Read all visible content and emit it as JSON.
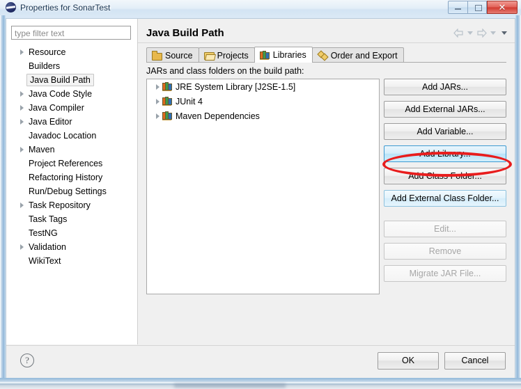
{
  "window": {
    "title": "Properties for SonarTest",
    "app_icon": "eclipse-icon",
    "minimize_label": "",
    "maximize_label": "",
    "close_label": "✕"
  },
  "filter": {
    "placeholder": "type filter text",
    "value": ""
  },
  "sidebar": {
    "items": [
      {
        "label": "Resource",
        "expandable": true,
        "selected": false
      },
      {
        "label": "Builders",
        "expandable": false,
        "selected": false
      },
      {
        "label": "Java Build Path",
        "expandable": false,
        "selected": true
      },
      {
        "label": "Java Code Style",
        "expandable": true,
        "selected": false
      },
      {
        "label": "Java Compiler",
        "expandable": true,
        "selected": false
      },
      {
        "label": "Java Editor",
        "expandable": true,
        "selected": false
      },
      {
        "label": "Javadoc Location",
        "expandable": false,
        "selected": false
      },
      {
        "label": "Maven",
        "expandable": true,
        "selected": false
      },
      {
        "label": "Project References",
        "expandable": false,
        "selected": false
      },
      {
        "label": "Refactoring History",
        "expandable": false,
        "selected": false
      },
      {
        "label": "Run/Debug Settings",
        "expandable": false,
        "selected": false
      },
      {
        "label": "Task Repository",
        "expandable": true,
        "selected": false
      },
      {
        "label": "Task Tags",
        "expandable": false,
        "selected": false
      },
      {
        "label": "TestNG",
        "expandable": false,
        "selected": false
      },
      {
        "label": "Validation",
        "expandable": true,
        "selected": false
      },
      {
        "label": "WikiText",
        "expandable": false,
        "selected": false
      }
    ]
  },
  "page": {
    "title": "Java Build Path",
    "nav": {
      "back_icon": "back-arrow-icon",
      "back_menu_icon": "chevron-down-icon",
      "forward_icon": "forward-arrow-icon",
      "forward_menu_icon": "chevron-down-icon",
      "menu_icon": "chevron-down-icon"
    }
  },
  "tabs": [
    {
      "label": "Source",
      "icon": "source-folder-icon",
      "active": false
    },
    {
      "label": "Projects",
      "icon": "projects-folder-icon",
      "active": false
    },
    {
      "label": "Libraries",
      "icon": "libraries-books-icon",
      "active": true
    },
    {
      "label": "Order and Export",
      "icon": "order-export-icon",
      "active": false
    }
  ],
  "libraries_panel": {
    "caption": "JARs and class folders on the build path:",
    "entries": [
      {
        "label": "JRE System Library [J2SE-1.5]",
        "icon": "library-books-icon",
        "expandable": true
      },
      {
        "label": "JUnit 4",
        "icon": "library-books-icon",
        "expandable": true
      },
      {
        "label": "Maven Dependencies",
        "icon": "library-books-icon",
        "expandable": true
      }
    ],
    "buttons": [
      {
        "label": "Add JARs...",
        "state": "normal"
      },
      {
        "label": "Add External JARs...",
        "state": "normal"
      },
      {
        "label": "Add Variable...",
        "state": "normal"
      },
      {
        "label": "Add Library...",
        "state": "hover"
      },
      {
        "label": "Add Class Folder...",
        "state": "normal"
      },
      {
        "label": "Add External Class Folder...",
        "state": "tinted"
      },
      {
        "label": "Edit...",
        "state": "disabled"
      },
      {
        "label": "Remove",
        "state": "disabled"
      },
      {
        "label": "Migrate JAR File...",
        "state": "disabled"
      }
    ]
  },
  "annotation": {
    "shape": "ellipse",
    "color": "#e81d1d",
    "target_button": "Add Library..."
  },
  "footer": {
    "help_icon": "help-question-icon",
    "help_glyph": "?",
    "ok_label": "OK",
    "cancel_label": "Cancel"
  },
  "colors": {
    "accent": "#3c9ad1",
    "annotation": "#e81d1d",
    "dialog_bg": "#f0f0f0",
    "title_text": "#16324f"
  }
}
